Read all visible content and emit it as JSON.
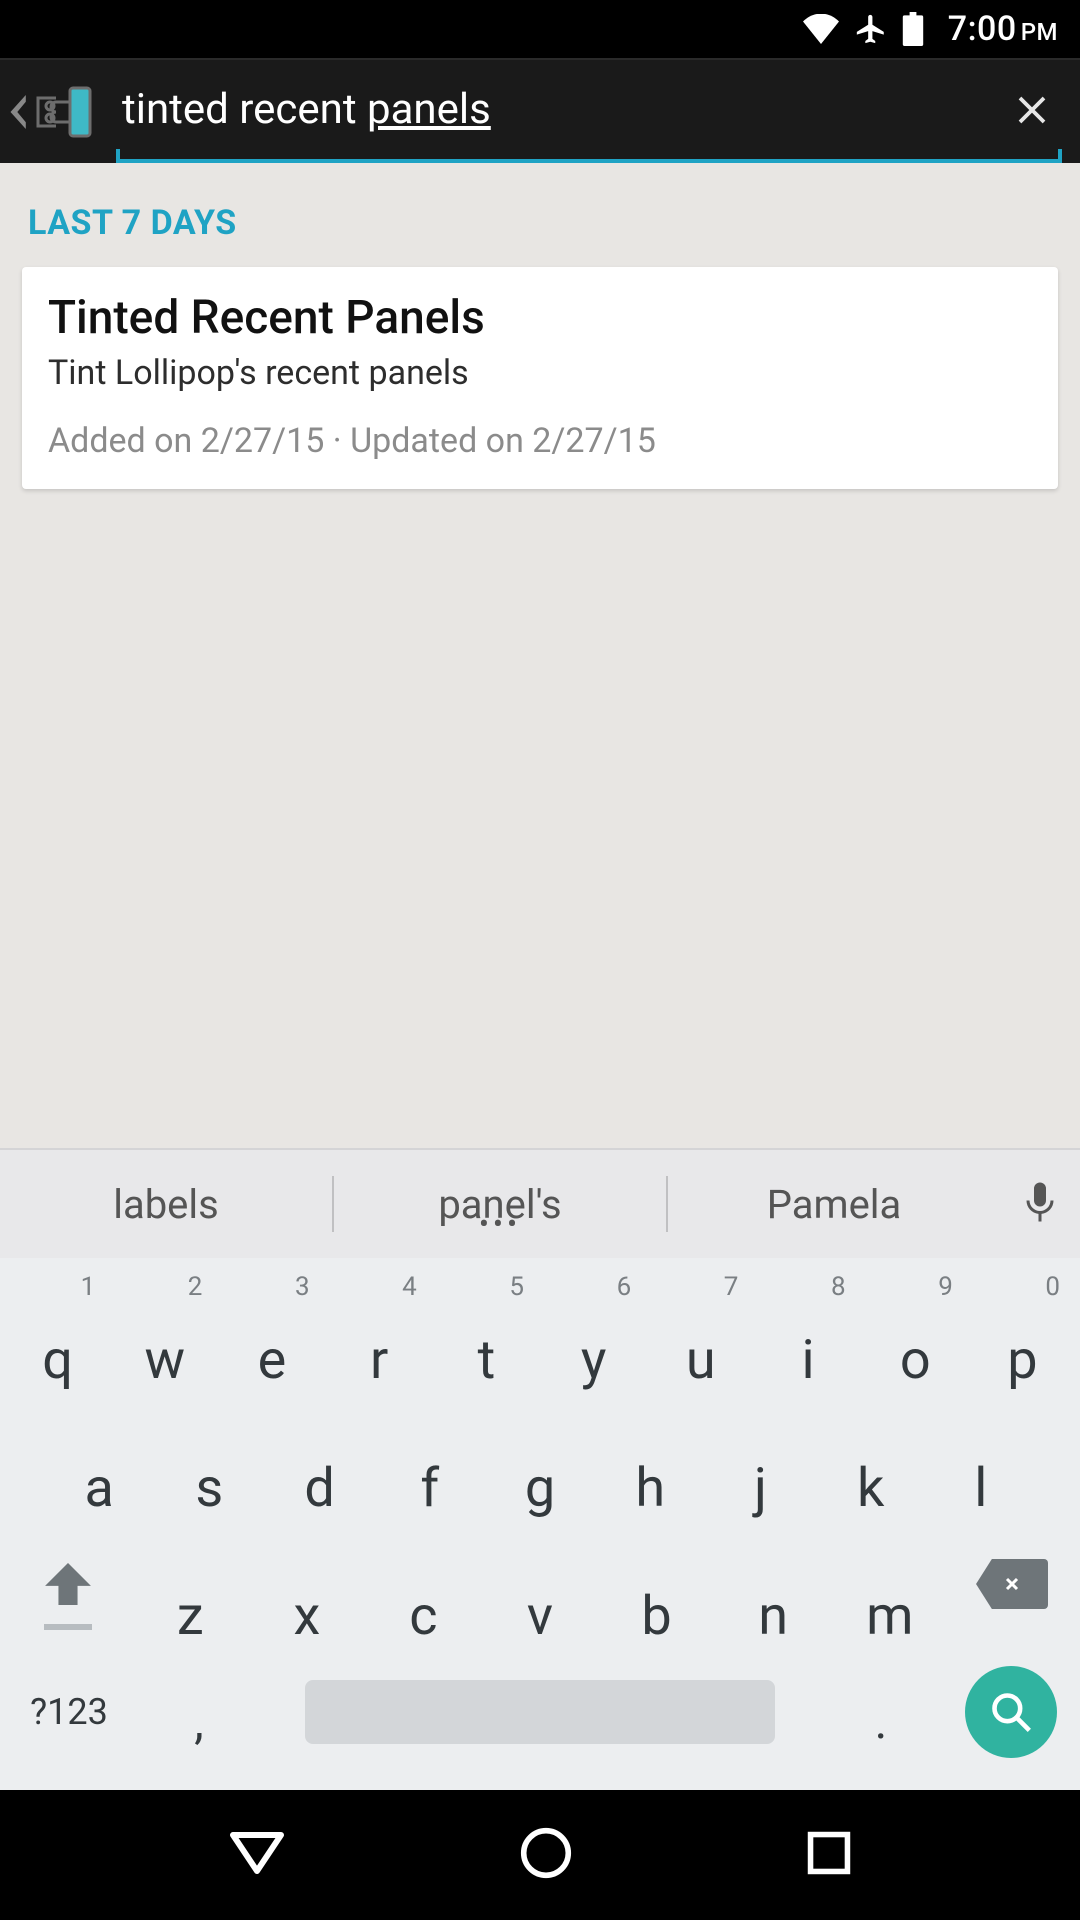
{
  "status": {
    "time": "7:00",
    "ampm": "PM"
  },
  "search": {
    "value_plain": "tinted recent ",
    "value_underlined": "panels"
  },
  "section": {
    "label": "LAST 7 DAYS"
  },
  "result": {
    "title": "Tinted Recent Panels",
    "subtitle": "Tint Lollipop's recent panels",
    "meta": "Added on 2/27/15 · Updated on 2/27/15"
  },
  "suggestions": {
    "s1": "labels",
    "s2": "panel's",
    "s3": "Pamela"
  },
  "keyboard": {
    "row1": {
      "k0": "q",
      "k1": "w",
      "k2": "e",
      "k3": "r",
      "k4": "t",
      "k5": "y",
      "k6": "u",
      "k7": "i",
      "k8": "o",
      "k9": "p",
      "h0": "1",
      "h1": "2",
      "h2": "3",
      "h3": "4",
      "h4": "5",
      "h5": "6",
      "h6": "7",
      "h7": "8",
      "h8": "9",
      "h9": "0"
    },
    "row2": {
      "k0": "a",
      "k1": "s",
      "k2": "d",
      "k3": "f",
      "k4": "g",
      "k5": "h",
      "k6": "j",
      "k7": "k",
      "k8": "l"
    },
    "row3": {
      "k0": "z",
      "k1": "x",
      "k2": "c",
      "k3": "v",
      "k4": "b",
      "k5": "n",
      "k6": "m"
    },
    "sym": "?123",
    "comma": ",",
    "period": "."
  }
}
